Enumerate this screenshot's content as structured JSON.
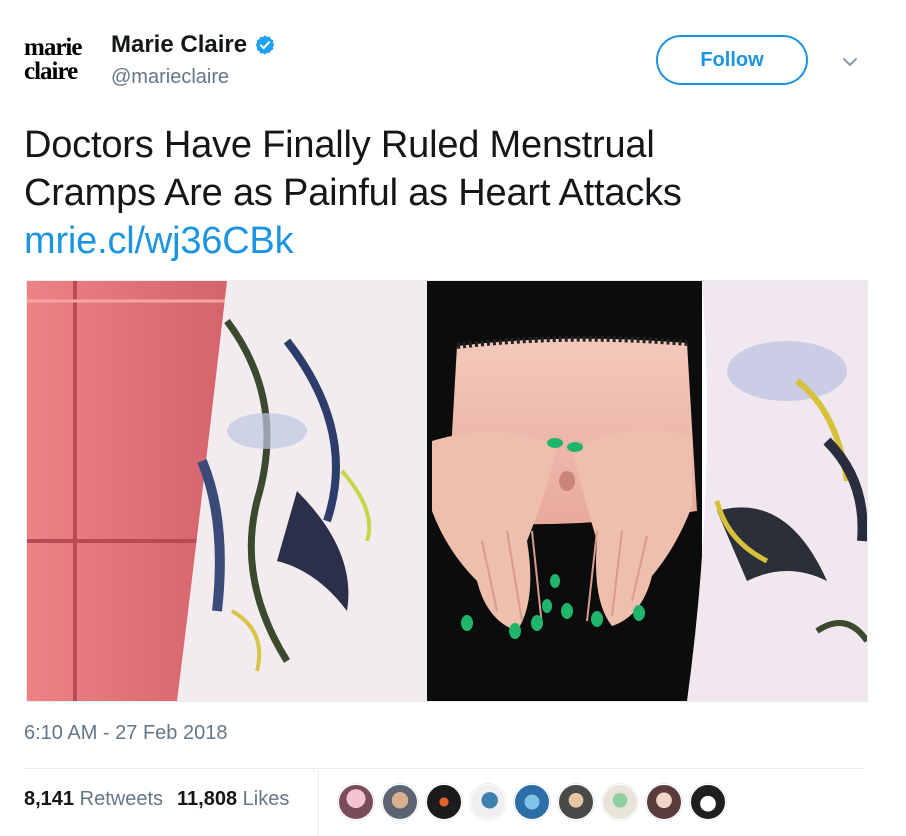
{
  "account": {
    "logo_line1": "marie",
    "logo_line2": "claire",
    "display_name": "Marie Claire",
    "handle": "@marieclaire",
    "verified_icon": "verified-badge-icon"
  },
  "actions": {
    "follow_label": "Follow",
    "more_icon": "chevron-down-icon"
  },
  "tweet": {
    "line1": "Doctors Have Finally Ruled Menstrual",
    "line2": "Cramps Are as Painful as Heart Attacks",
    "link": "mrie.cl/wj36CBk",
    "timestamp": "6:10 AM - 27 Feb 2018"
  },
  "stats": {
    "retweets_count": "8,141",
    "retweets_label": "Retweets",
    "likes_count": "11,808",
    "likes_label": "Likes"
  },
  "colors": {
    "brand_blue": "#1b95e0",
    "nail_green": "#1fb56b",
    "tile_pink": "#e8787c"
  }
}
